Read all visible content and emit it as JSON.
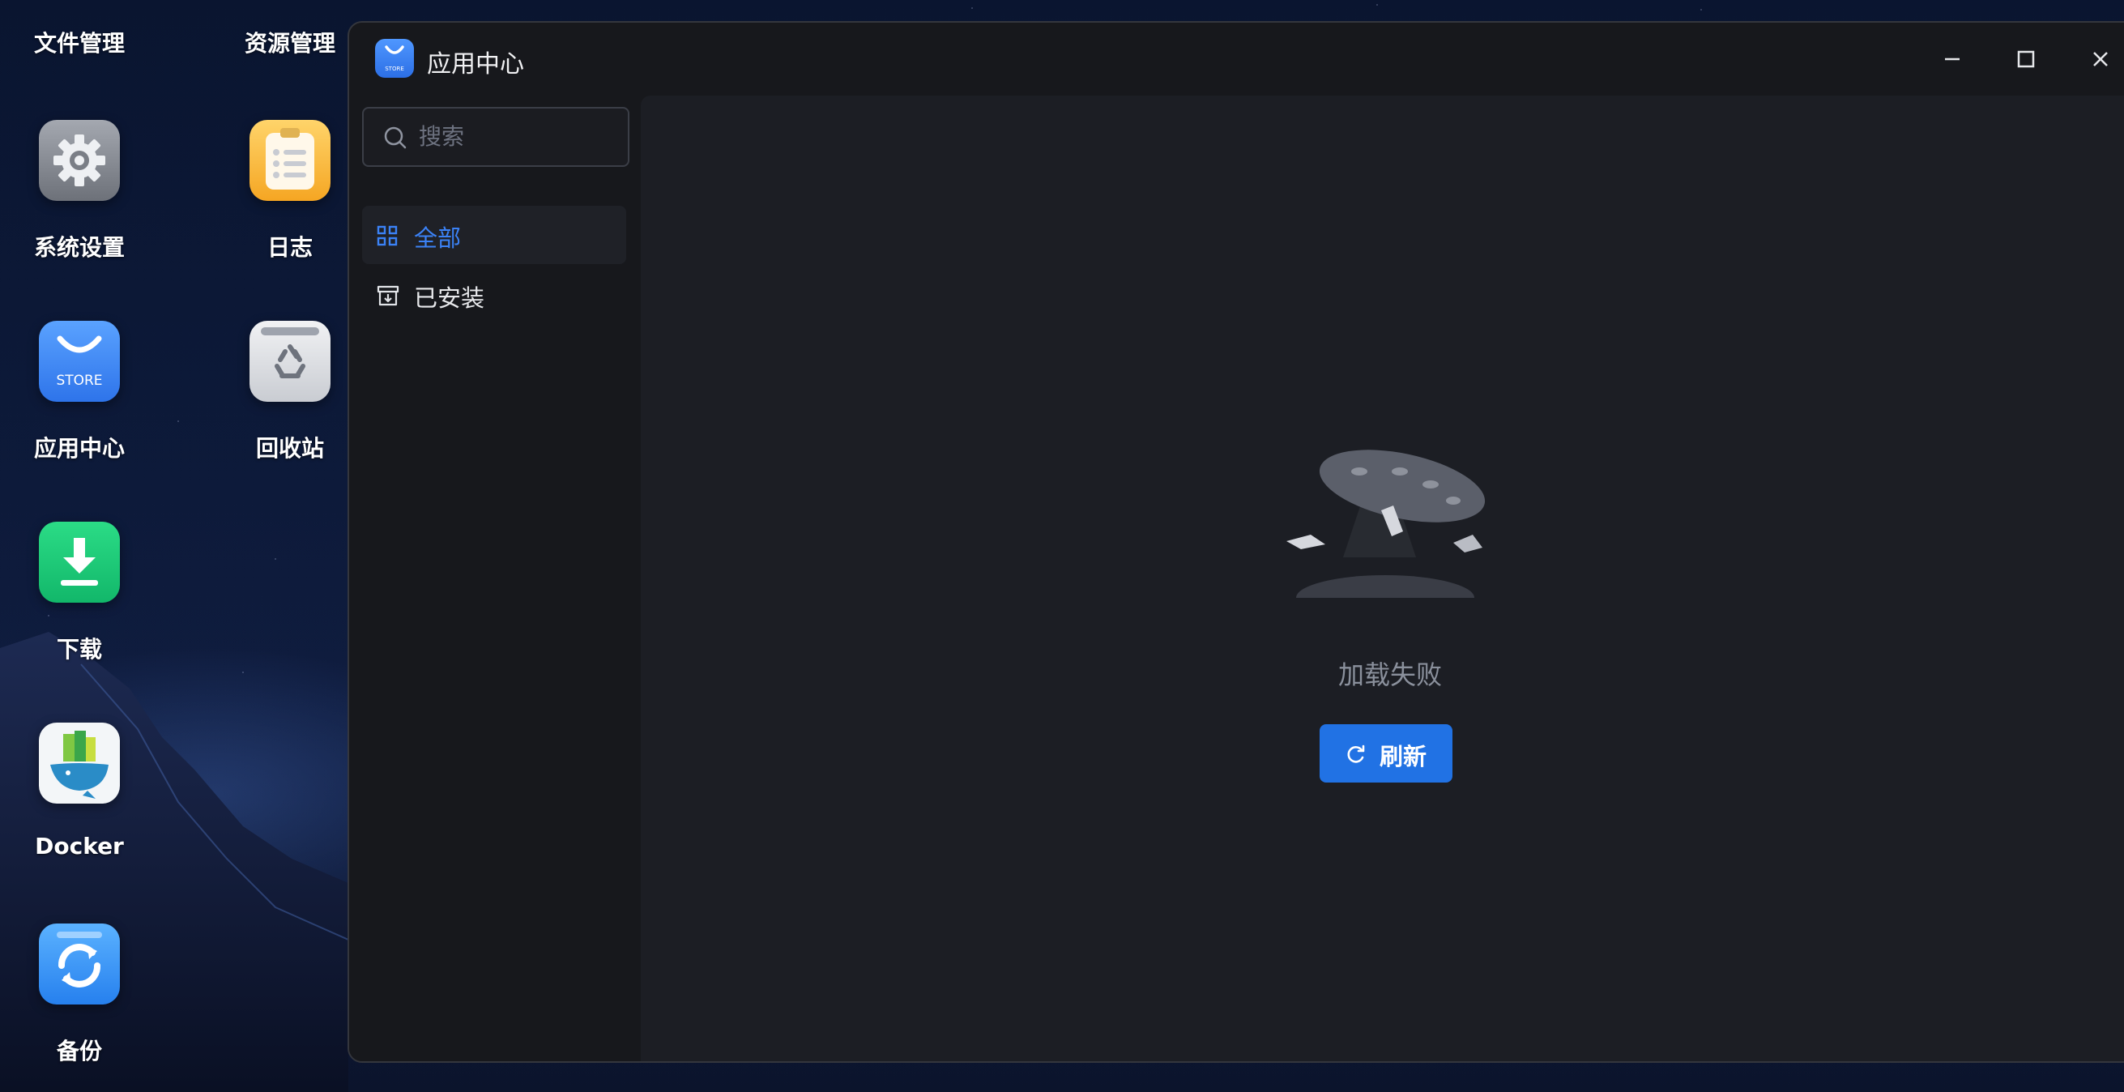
{
  "desktop": {
    "top_labels": [
      "文件管理",
      "资源管理"
    ],
    "icons": [
      {
        "label": "系统设置",
        "icon": "gear-icon"
      },
      {
        "label": "日志",
        "icon": "notepad-icon"
      },
      {
        "label": "应用中心",
        "icon": "store-icon"
      },
      {
        "label": "回收站",
        "icon": "recycle-bin-icon"
      },
      {
        "label": "下载",
        "icon": "download-icon"
      },
      {
        "label": "Docker",
        "icon": "docker-icon"
      },
      {
        "label": "备份",
        "icon": "backup-icon"
      }
    ]
  },
  "window": {
    "title": "应用中心",
    "logo_text": "STORE",
    "controls": [
      "minimize-icon",
      "maximize-icon",
      "close-icon"
    ]
  },
  "sidebar": {
    "search_placeholder": "搜索",
    "items": [
      {
        "label": "全部",
        "icon": "grid-icon",
        "active": true
      },
      {
        "label": "已安装",
        "icon": "installed-box-icon",
        "active": false
      }
    ]
  },
  "main": {
    "empty_message": "加载失败",
    "refresh_label": "刷新"
  },
  "colors": {
    "accent": "#2172e4",
    "active_text": "#3b82f6",
    "window_bg": "#17181c",
    "content_bg": "#1c1e24"
  }
}
